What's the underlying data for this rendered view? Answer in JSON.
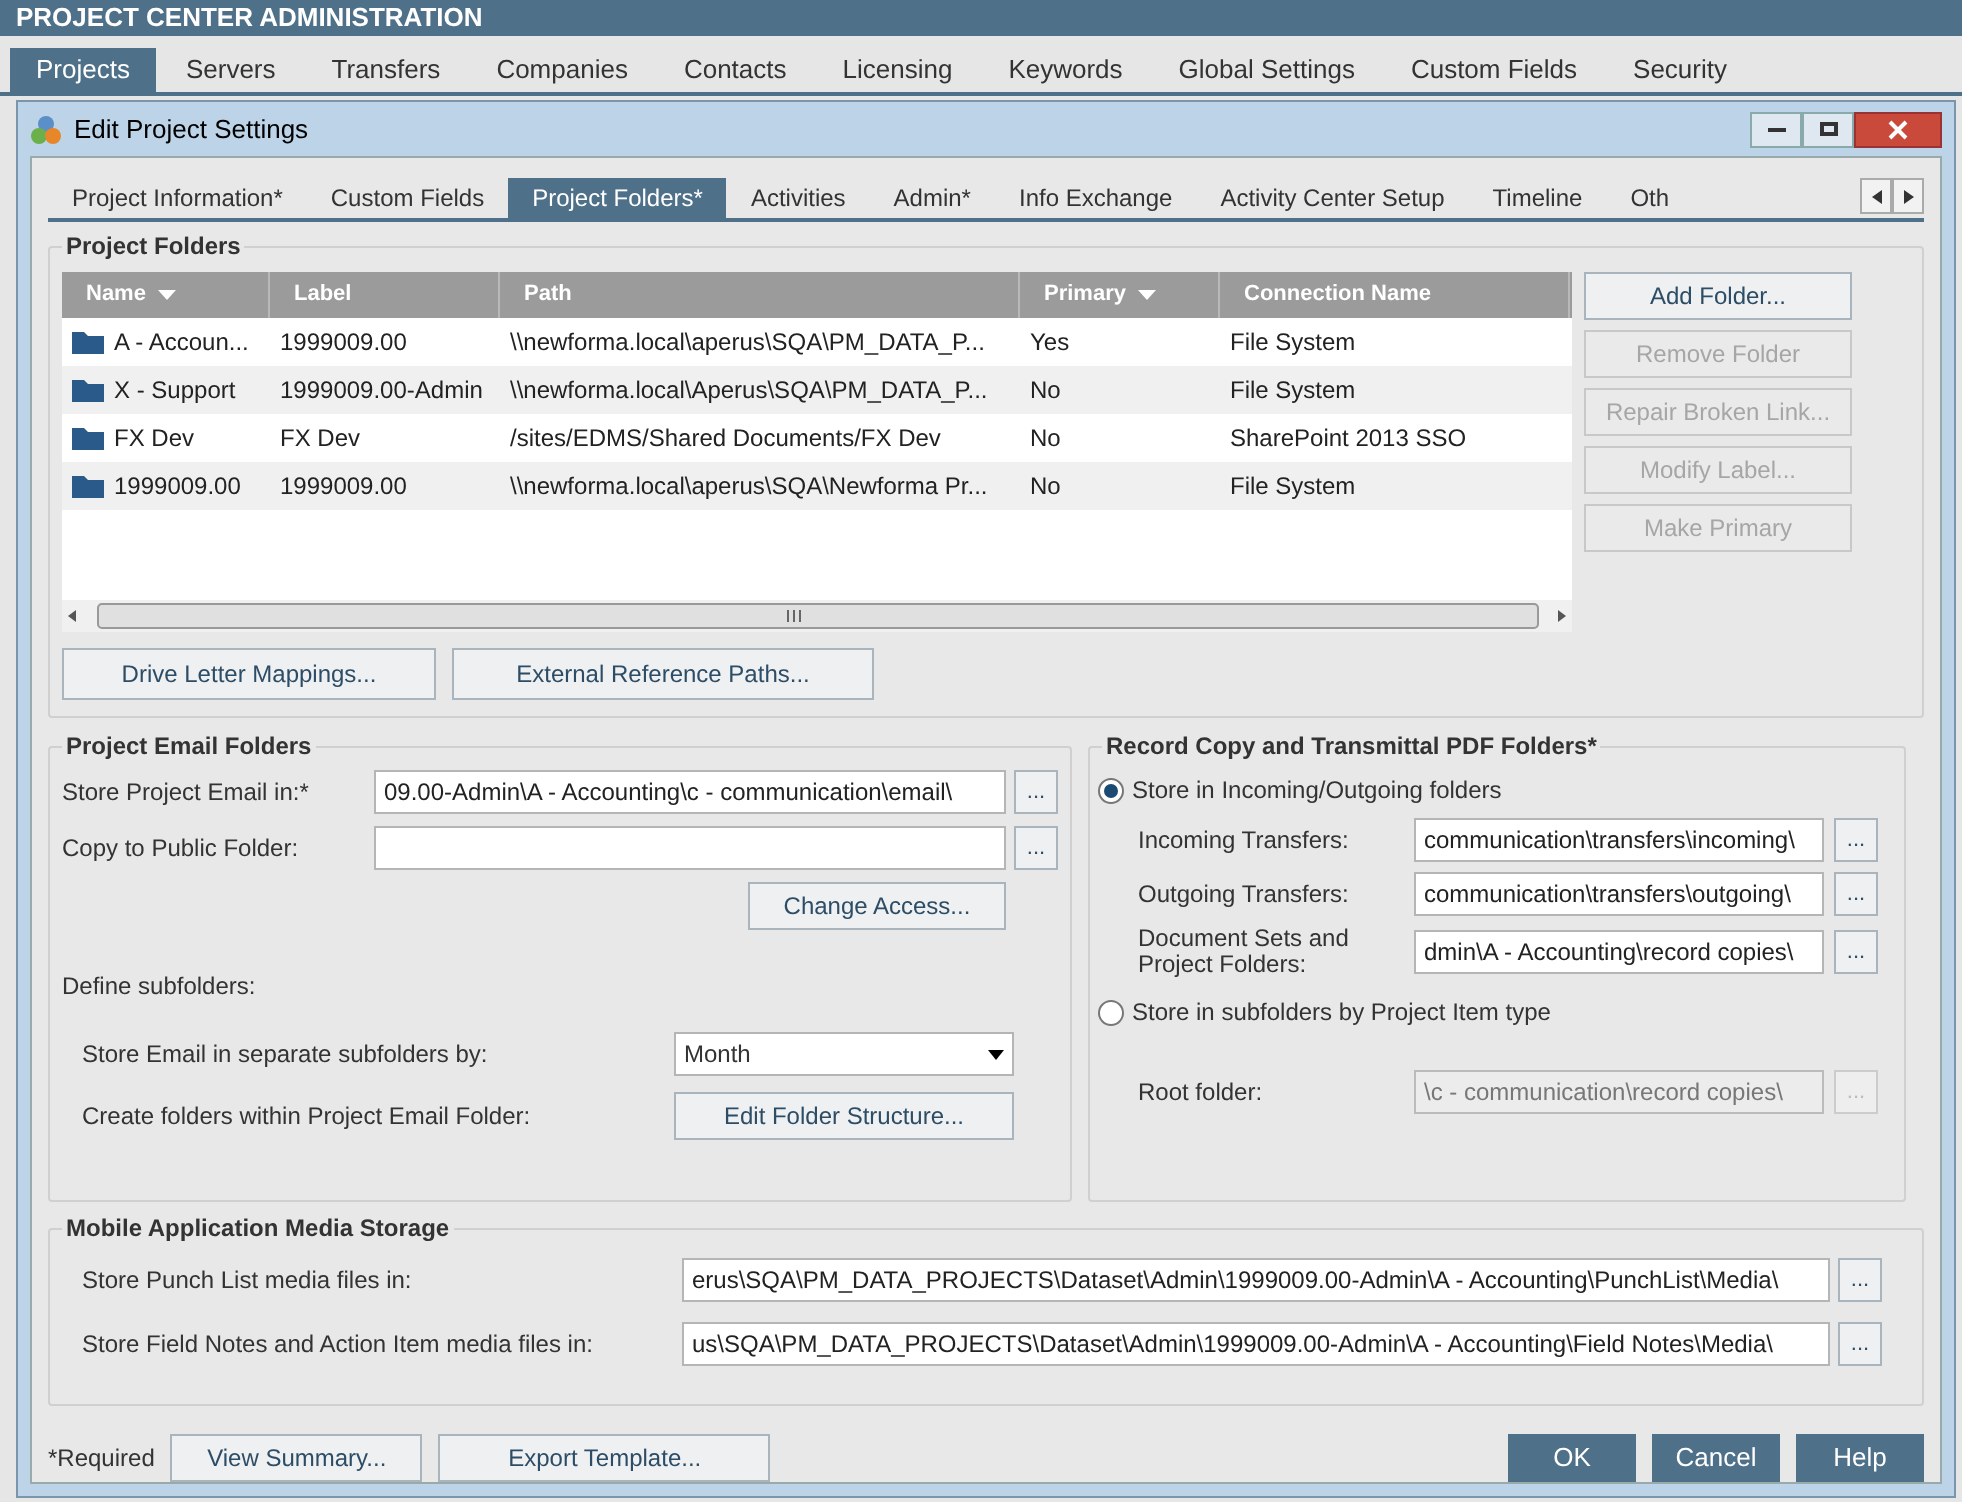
{
  "app_title": "PROJECT CENTER ADMINISTRATION",
  "main_tabs": [
    {
      "label": "Projects",
      "selected": true
    },
    {
      "label": "Servers",
      "selected": false
    },
    {
      "label": "Transfers",
      "selected": false
    },
    {
      "label": "Companies",
      "selected": false
    },
    {
      "label": "Contacts",
      "selected": false
    },
    {
      "label": "Licensing",
      "selected": false
    },
    {
      "label": "Keywords",
      "selected": false
    },
    {
      "label": "Global Settings",
      "selected": false
    },
    {
      "label": "Custom Fields",
      "selected": false
    },
    {
      "label": "Security",
      "selected": false
    }
  ],
  "dialog": {
    "title": "Edit Project Settings",
    "tabs": [
      {
        "label": "Project Information*",
        "selected": false
      },
      {
        "label": "Custom Fields",
        "selected": false
      },
      {
        "label": "Project Folders*",
        "selected": true
      },
      {
        "label": "Activities",
        "selected": false
      },
      {
        "label": "Admin*",
        "selected": false
      },
      {
        "label": "Info Exchange",
        "selected": false
      },
      {
        "label": "Activity Center Setup",
        "selected": false
      },
      {
        "label": "Timeline",
        "selected": false
      },
      {
        "label": "Oth",
        "selected": false
      }
    ],
    "project_folders": {
      "title": "Project Folders",
      "columns": [
        {
          "label": "Name",
          "sorted": true
        },
        {
          "label": "Label",
          "sorted": false
        },
        {
          "label": "Path",
          "sorted": false
        },
        {
          "label": "Primary",
          "sorted": true
        },
        {
          "label": "Connection Name",
          "sorted": false
        }
      ],
      "rows": [
        [
          "A - Accoun...",
          "1999009.00",
          "\\\\newforma.local\\aperus\\SQA\\PM_DATA_P...",
          "Yes",
          "File System"
        ],
        [
          "X - Support",
          "1999009.00-Admin",
          "\\\\newforma.local\\Aperus\\SQA\\PM_DATA_P...",
          "No",
          "File System"
        ],
        [
          "FX Dev",
          "FX Dev",
          "/sites/EDMS/Shared Documents/FX Dev",
          "No",
          "SharePoint 2013 SSO"
        ],
        [
          "1999009.00",
          "1999009.00",
          "\\\\newforma.local\\aperus\\SQA\\Newforma Pr...",
          "No",
          "File System"
        ]
      ],
      "side_buttons": [
        {
          "label": "Add Folder...",
          "disabled": false
        },
        {
          "label": "Remove Folder",
          "disabled": true
        },
        {
          "label": "Repair Broken Link...",
          "disabled": true
        },
        {
          "label": "Modify Label...",
          "disabled": true
        },
        {
          "label": "Make Primary",
          "disabled": true
        }
      ],
      "bottom_buttons": [
        "Drive Letter Mappings...",
        "External Reference Paths..."
      ]
    },
    "email_folders": {
      "title": "Project Email Folders",
      "store_label": "Store Project Email in:*",
      "store_value": "09.00-Admin\\A - Accounting\\c - communication\\email\\",
      "public_label": "Copy to Public Folder:",
      "browse": "...",
      "change_access": "Change Access...",
      "define_label": "Define subfolders:",
      "separate_label": "Store Email in separate subfolders by:",
      "separate_value": "Month",
      "create_label": "Create folders within Project Email Folder:",
      "edit_structure": "Edit Folder Structure..."
    },
    "record_copy": {
      "title": "Record Copy and Transmittal PDF Folders*",
      "options": [
        {
          "label": "Store in Incoming/Outgoing folders",
          "selected": true,
          "fields": [
            {
              "label": "Incoming Transfers:",
              "value": "communication\\transfers\\incoming\\",
              "disabled": false
            },
            {
              "label": "Outgoing Transfers:",
              "value": "communication\\transfers\\outgoing\\",
              "disabled": false
            },
            {
              "label": "Document Sets and Project Folders:",
              "value": "dmin\\A - Accounting\\record copies\\",
              "disabled": false
            }
          ]
        },
        {
          "label": "Store in subfolders by Project Item type",
          "selected": false,
          "fields": [
            {
              "label": "Root folder:",
              "value": "\\c - communication\\record copies\\",
              "disabled": true
            }
          ]
        }
      ],
      "browse": "..."
    },
    "mobile": {
      "title": "Mobile Application Media Storage",
      "browse": "...",
      "fields": [
        {
          "label": "Store Punch List media files in:",
          "value": "erus\\SQA\\PM_DATA_PROJECTS\\Dataset\\Admin\\1999009.00-Admin\\A - Accounting\\PunchList\\Media\\"
        },
        {
          "label": "Store Field Notes and Action Item media files in:",
          "value": "us\\SQA\\PM_DATA_PROJECTS\\Dataset\\Admin\\1999009.00-Admin\\A - Accounting\\Field Notes\\Media\\"
        }
      ]
    },
    "required_note": "*Required",
    "footer_left": [
      "View Summary...",
      "Export Template..."
    ],
    "footer_right": [
      "OK",
      "Cancel",
      "Help"
    ]
  }
}
